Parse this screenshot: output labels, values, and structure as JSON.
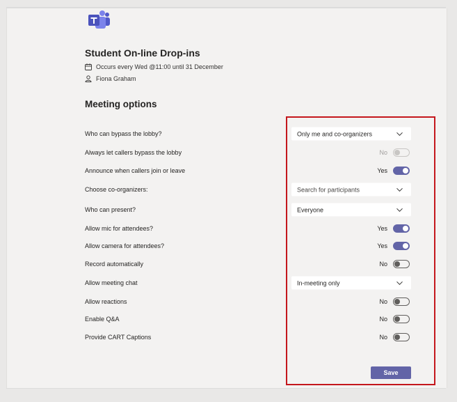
{
  "meeting": {
    "title": "Student On-line Drop-ins",
    "recurrence": "Occurs every Wed @11:00 until 31 December",
    "organizer": "Fiona Graham"
  },
  "section_title": "Meeting options",
  "options": {
    "bypass_lobby": {
      "label": "Who can bypass the lobby?",
      "value": "Only me and co-organizers"
    },
    "callers_bypass": {
      "label": "Always let callers bypass the lobby",
      "state": "No",
      "on": false,
      "disabled": true
    },
    "announce_callers": {
      "label": "Announce when callers join or leave",
      "state": "Yes",
      "on": true
    },
    "co_organizers": {
      "label": "Choose co-organizers:",
      "placeholder": "Search for participants"
    },
    "who_present": {
      "label": "Who can present?",
      "value": "Everyone"
    },
    "allow_mic": {
      "label": "Allow mic for attendees?",
      "state": "Yes",
      "on": true
    },
    "allow_camera": {
      "label": "Allow camera for attendees?",
      "state": "Yes",
      "on": true
    },
    "record_auto": {
      "label": "Record automatically",
      "state": "No",
      "on": false
    },
    "meeting_chat": {
      "label": "Allow meeting chat",
      "value": "In-meeting only"
    },
    "allow_reactions": {
      "label": "Allow reactions",
      "state": "No",
      "on": false
    },
    "enable_qa": {
      "label": "Enable Q&A",
      "state": "No",
      "on": false
    },
    "cart_captions": {
      "label": "Provide CART Captions",
      "state": "No",
      "on": false
    }
  },
  "save_label": "Save",
  "colors": {
    "accent": "#6264a7",
    "highlight_border": "#c4161c"
  },
  "icons": {
    "logo": "teams-logo-icon",
    "calendar": "calendar-icon",
    "person": "person-icon",
    "dropdown": "chevron-down-icon"
  }
}
